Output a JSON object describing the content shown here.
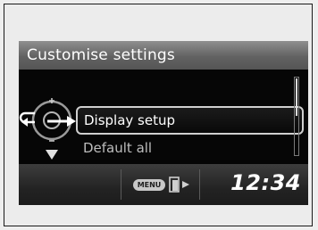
{
  "screen": {
    "title": "Customise settings",
    "items": [
      {
        "label": "Display setup",
        "selected": true
      },
      {
        "label": "Default all",
        "selected": false
      }
    ]
  },
  "status_bar": {
    "menu_badge": "MENU",
    "clock": "12:34"
  },
  "icons": {
    "knob": "interface-dial-icon",
    "back": "back-arrow-icon",
    "enter": "enter-arrow-icon",
    "down": "down-triangle-icon",
    "exit": "exit-door-icon"
  },
  "colors": {
    "screen_bg": "#050505",
    "title_bar": "#6e6e6e",
    "highlight_border": "#cfcfcf",
    "text": "#ffffff",
    "dim_text": "#bdbdbd"
  }
}
